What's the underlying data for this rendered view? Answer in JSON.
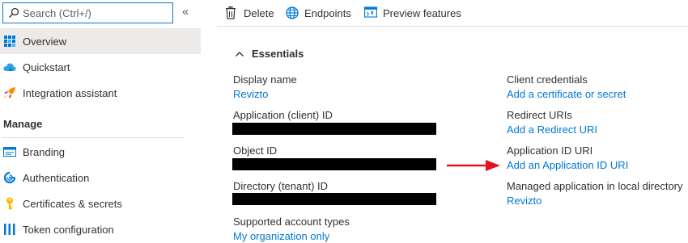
{
  "search": {
    "placeholder": "Search (Ctrl+/)"
  },
  "sidebar": {
    "collapse_label": "«",
    "items": [
      {
        "label": "Overview",
        "icon": "overview-grid-icon"
      },
      {
        "label": "Quickstart",
        "icon": "cloud-icon"
      },
      {
        "label": "Integration assistant",
        "icon": "rocket-icon"
      }
    ],
    "manage_label": "Manage",
    "manage_items": [
      {
        "label": "Branding",
        "icon": "branding-icon"
      },
      {
        "label": "Authentication",
        "icon": "authentication-icon"
      },
      {
        "label": "Certificates & secrets",
        "icon": "key-icon"
      },
      {
        "label": "Token configuration",
        "icon": "token-bars-icon"
      }
    ]
  },
  "toolbar": {
    "delete_label": "Delete",
    "endpoints_label": "Endpoints",
    "preview_label": "Preview features"
  },
  "essentials": {
    "label": "Essentials",
    "left": {
      "display_name_label": "Display name",
      "display_name_value": "Revizto",
      "app_id_label": "Application (client) ID",
      "object_id_label": "Object ID",
      "directory_id_label": "Directory (tenant) ID",
      "account_types_label": "Supported account types",
      "account_types_value": "My organization only"
    },
    "right": {
      "client_credentials_label": "Client credentials",
      "client_credentials_value": "Add a certificate or secret",
      "redirect_uris_label": "Redirect URIs",
      "redirect_uris_value": "Add a Redirect URI",
      "app_id_uri_label": "Application ID URI",
      "app_id_uri_value": "Add an Application ID URI",
      "managed_app_label": "Managed application in local directory",
      "managed_app_value": "Revizto"
    }
  },
  "colors": {
    "link": "#0078d4",
    "accent": "#0078d4",
    "annotation_arrow": "#e81123",
    "active_nav": "#edebe9"
  }
}
